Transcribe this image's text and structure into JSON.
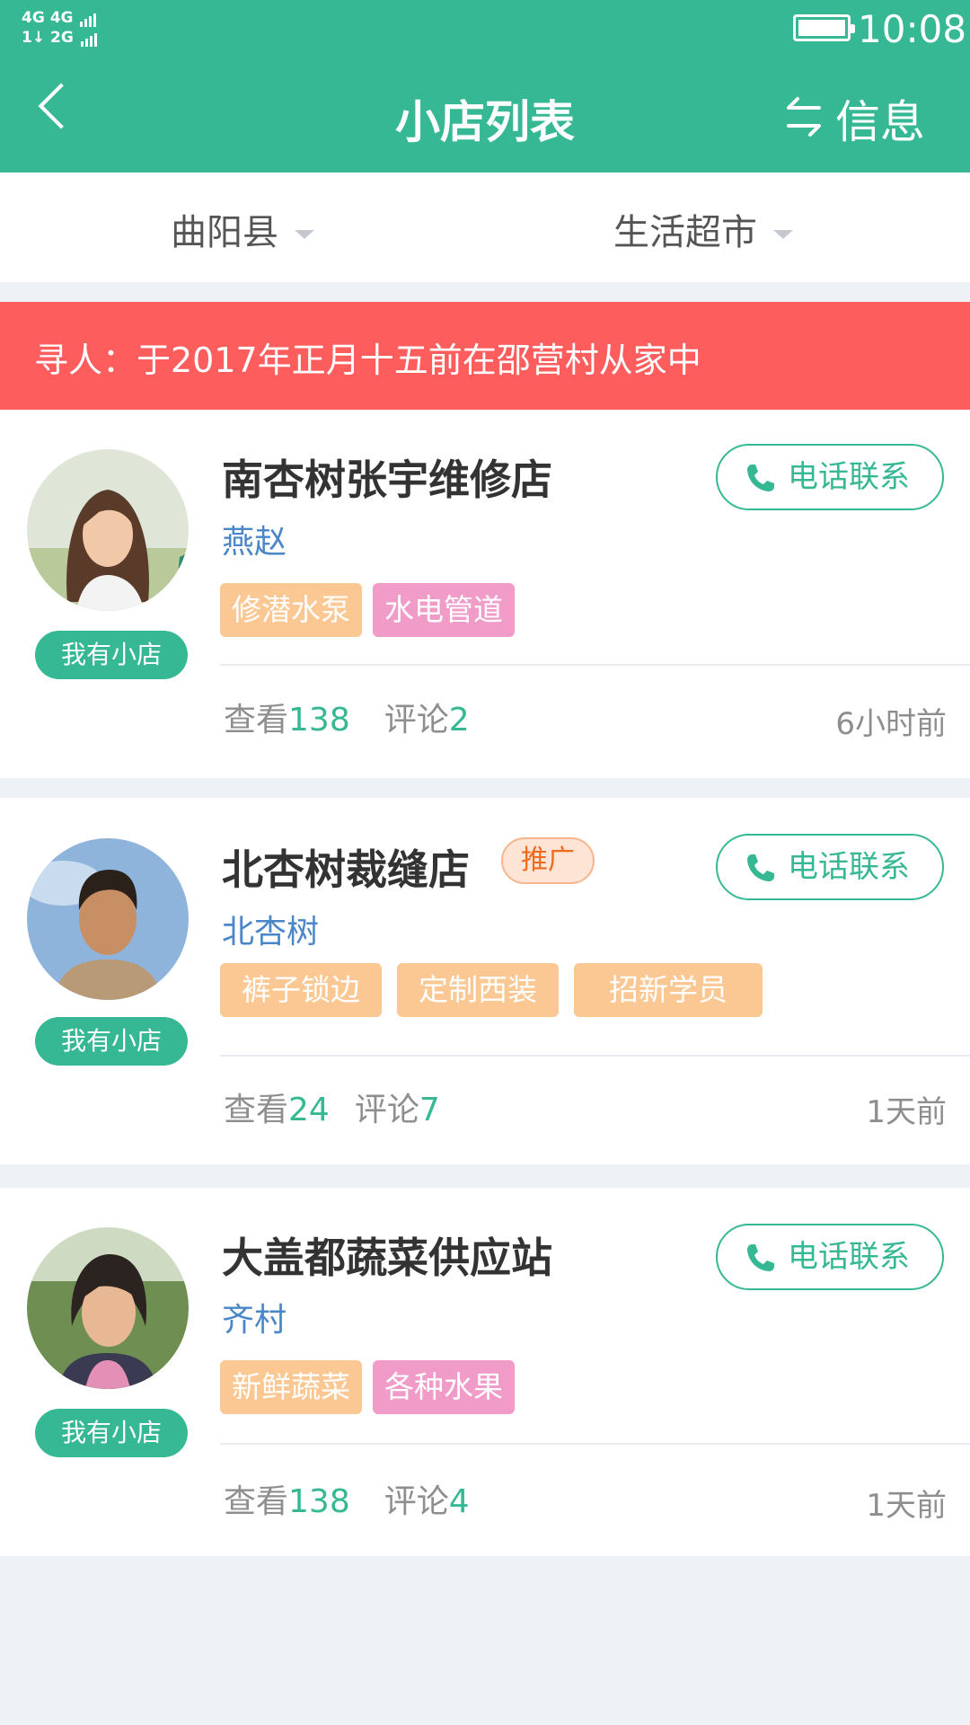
{
  "status_bar": {
    "network_line1": "4G 4G",
    "network_line2": "1↓ 2G",
    "time": "10:08"
  },
  "header": {
    "title": "小店列表",
    "back_icon": "chevron-left-icon",
    "switch_icon": "swap-arrows-icon",
    "right_label": "信息",
    "background_color": "#36b894"
  },
  "filters": [
    {
      "label": "曲阳县"
    },
    {
      "label": "生活超市"
    }
  ],
  "notice": {
    "text": "寻人：于2017年正月十五前在邵营村从家中",
    "background_color": "#fd5d5d"
  },
  "shops": [
    {
      "name": "南杏树张宇维修店",
      "location": "燕赵",
      "badge": "我有小店",
      "call_label": "电话联系",
      "tags": [
        {
          "label": "修潜水泵",
          "color": "orange"
        },
        {
          "label": "水电管道",
          "color": "pink"
        }
      ],
      "views_label": "查看",
      "views": "138",
      "comments_label": "评论",
      "comments": "2",
      "time": "6小时前"
    },
    {
      "name": "北杏树裁缝店",
      "promo": "推广",
      "location": "北杏树",
      "badge": "我有小店",
      "call_label": "电话联系",
      "tags": [
        {
          "label": "裤子锁边",
          "color": "orange"
        },
        {
          "label": "定制西装",
          "color": "orange"
        },
        {
          "label": "招新学员",
          "color": "orange"
        }
      ],
      "views_label": "查看",
      "views": "24",
      "comments_label": "评论",
      "comments": "7",
      "time": "1天前"
    },
    {
      "name": "大盖都蔬菜供应站",
      "location": "齐村",
      "badge": "我有小店",
      "call_label": "电话联系",
      "tags": [
        {
          "label": "新鲜蔬菜",
          "color": "orange"
        },
        {
          "label": "各种水果",
          "color": "pink"
        }
      ],
      "views_label": "查看",
      "views": "138",
      "comments_label": "评论",
      "comments": "4",
      "time": "1天前"
    }
  ]
}
